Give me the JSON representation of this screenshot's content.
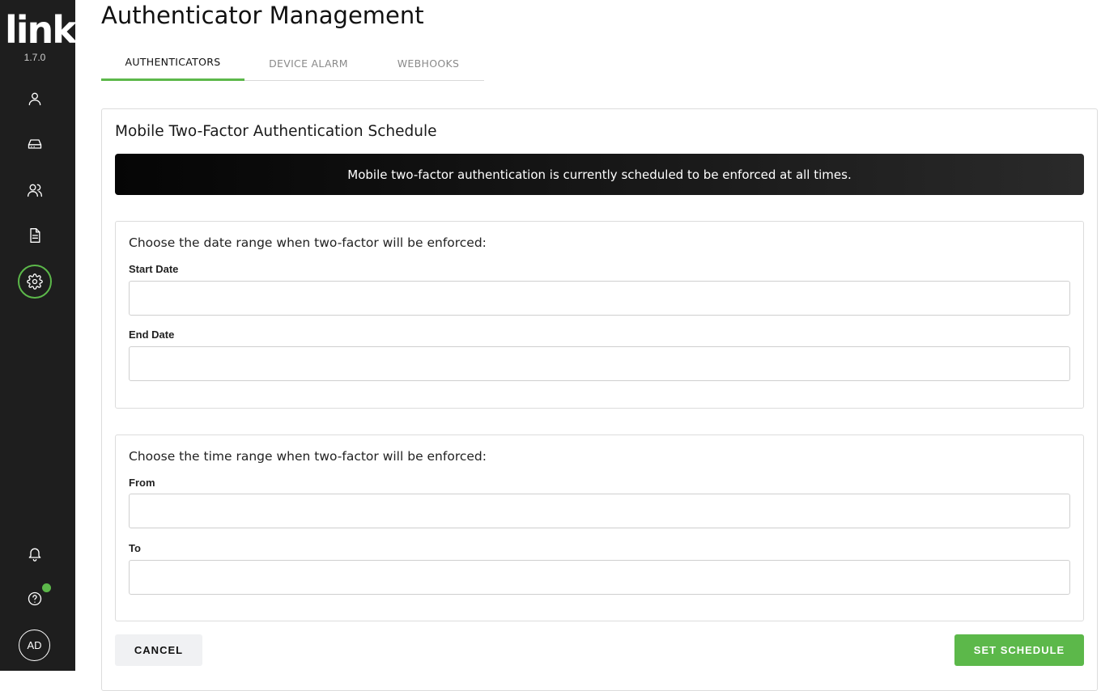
{
  "app": {
    "logo_text": "link",
    "version": "1.7.0",
    "user_initials": "AD",
    "accent_color": "#5cb84a",
    "sidebar_color": "#1e1e1e"
  },
  "sidebar": {
    "items": [
      {
        "icon": "user-icon",
        "active": false
      },
      {
        "icon": "device-drive-icon",
        "active": false
      },
      {
        "icon": "users-icon",
        "active": false
      },
      {
        "icon": "document-icon",
        "active": false
      },
      {
        "icon": "gear-icon",
        "active": true
      }
    ],
    "bottom": [
      {
        "icon": "bell-icon"
      },
      {
        "icon": "help-icon",
        "status_indicator": "green"
      }
    ]
  },
  "header": {
    "title": "Authenticator Management"
  },
  "tabs": [
    {
      "label": "AUTHENTICATORS",
      "active": true
    },
    {
      "label": "DEVICE ALARM",
      "active": false
    },
    {
      "label": "WEBHOOKS",
      "active": false
    }
  ],
  "schedule": {
    "title": "Mobile Two-Factor Authentication Schedule",
    "banner": "Mobile two-factor authentication is currently scheduled to be enforced at all times.",
    "date_range": {
      "title": "Choose the date range when two-factor will be enforced:",
      "start_label": "Start Date",
      "start_value": "",
      "end_label": "End Date",
      "end_value": ""
    },
    "time_range": {
      "title": "Choose the time range when two-factor will be enforced:",
      "from_label": "From",
      "from_value": "",
      "to_label": "To",
      "to_value": ""
    }
  },
  "actions": {
    "cancel_label": "CANCEL",
    "set_label": "SET SCHEDULE"
  }
}
